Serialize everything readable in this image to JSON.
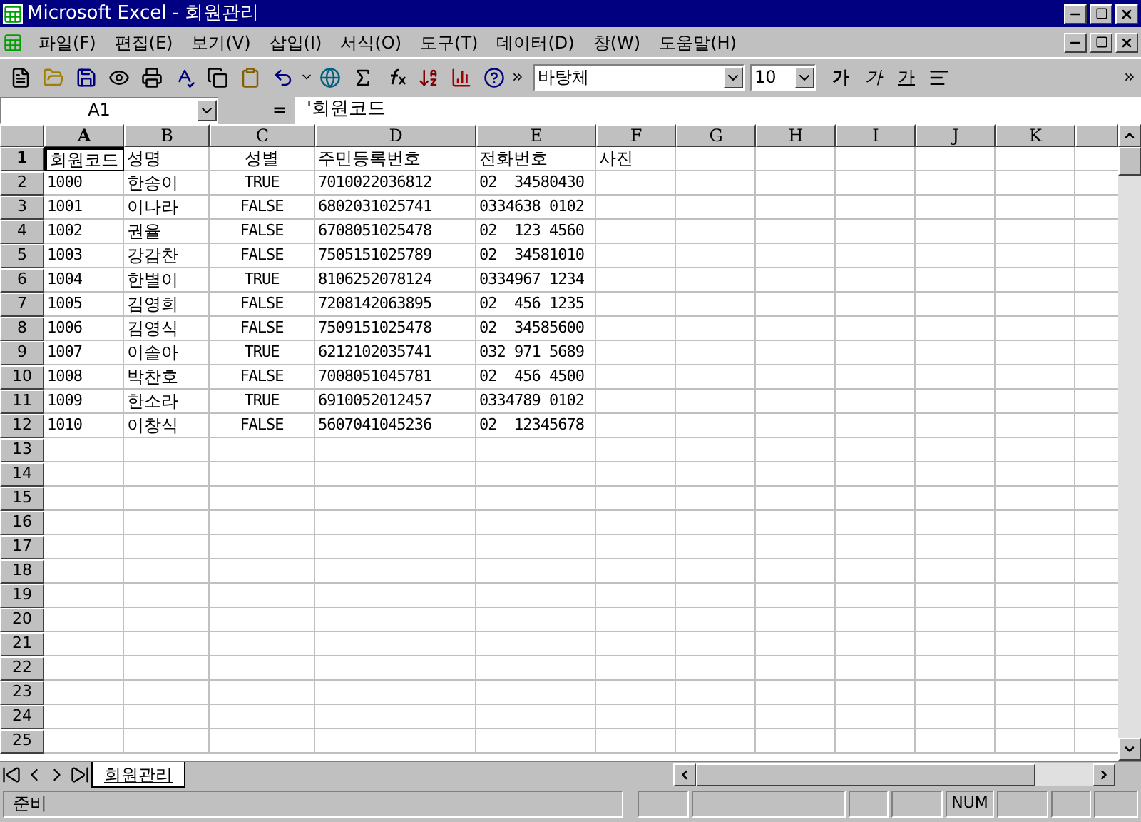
{
  "window": {
    "title": "Microsoft Excel - 회원관리"
  },
  "menu": [
    "파일(F)",
    "편집(E)",
    "보기(V)",
    "삽입(I)",
    "서식(O)",
    "도구(T)",
    "데이터(D)",
    "창(W)",
    "도움말(H)"
  ],
  "toolbar": {
    "font_name": "바탕체",
    "font_size": "10",
    "format_buttons": [
      {
        "label": "가",
        "kind": "bold"
      },
      {
        "label": "가",
        "kind": "italic"
      },
      {
        "label": "가",
        "kind": "underline"
      }
    ]
  },
  "formula_bar": {
    "cell_ref": "A1",
    "equals": "=",
    "content": "'회원코드"
  },
  "sheet": {
    "columns": [
      {
        "label": "A",
        "selected": true,
        "kind": "text"
      },
      {
        "label": "B",
        "selected": false,
        "kind": "text"
      },
      {
        "label": "C",
        "selected": false,
        "kind": "boolean"
      },
      {
        "label": "D",
        "selected": false,
        "kind": "text"
      },
      {
        "label": "E",
        "selected": false,
        "kind": "text"
      },
      {
        "label": "F",
        "selected": false,
        "kind": "text"
      },
      {
        "label": "G",
        "selected": false,
        "kind": "text"
      },
      {
        "label": "H",
        "selected": false,
        "kind": "text"
      },
      {
        "label": "I",
        "selected": false,
        "kind": "text"
      },
      {
        "label": "J",
        "selected": false,
        "kind": "text"
      },
      {
        "label": "K",
        "selected": false,
        "kind": "text"
      }
    ],
    "rows": [
      {
        "header": "1",
        "selected": true,
        "cells": [
          "회원코드",
          "성명",
          "성별",
          "주민등록번호",
          "전화번호",
          "사진"
        ]
      },
      {
        "header": "2",
        "selected": false,
        "cells": [
          "1000",
          "한송이",
          "TRUE",
          "7010022036812",
          "02  34580430"
        ]
      },
      {
        "header": "3",
        "selected": false,
        "cells": [
          "1001",
          "이나라",
          "FALSE",
          "6802031025741",
          "0334638 0102"
        ]
      },
      {
        "header": "4",
        "selected": false,
        "cells": [
          "1002",
          "권율",
          "FALSE",
          "6708051025478",
          "02  123 4560"
        ]
      },
      {
        "header": "5",
        "selected": false,
        "cells": [
          "1003",
          "강감찬",
          "FALSE",
          "7505151025789",
          "02  34581010"
        ]
      },
      {
        "header": "6",
        "selected": false,
        "cells": [
          "1004",
          "한별이",
          "TRUE",
          "8106252078124",
          "0334967 1234"
        ]
      },
      {
        "header": "7",
        "selected": false,
        "cells": [
          "1005",
          "김영희",
          "FALSE",
          "7208142063895",
          "02  456 1235"
        ]
      },
      {
        "header": "8",
        "selected": false,
        "cells": [
          "1006",
          "김영식",
          "FALSE",
          "7509151025478",
          "02  34585600"
        ]
      },
      {
        "header": "9",
        "selected": false,
        "cells": [
          "1007",
          "이솔아",
          "TRUE",
          "6212102035741",
          "032 971 5689"
        ]
      },
      {
        "header": "10",
        "selected": false,
        "cells": [
          "1008",
          "박찬호",
          "FALSE",
          "7008051045781",
          "02  456 4500"
        ]
      },
      {
        "header": "11",
        "selected": false,
        "cells": [
          "1009",
          "한소라",
          "TRUE",
          "6910052012457",
          "0334789 0102"
        ]
      },
      {
        "header": "12",
        "selected": false,
        "cells": [
          "1010",
          "이창식",
          "FALSE",
          "5607041045236",
          "02  12345678"
        ]
      },
      {
        "header": "13",
        "selected": false,
        "cells": []
      },
      {
        "header": "14",
        "selected": false,
        "cells": []
      },
      {
        "header": "15",
        "selected": false,
        "cells": []
      },
      {
        "header": "16",
        "selected": false,
        "cells": []
      },
      {
        "header": "17",
        "selected": false,
        "cells": []
      },
      {
        "header": "18",
        "selected": false,
        "cells": []
      },
      {
        "header": "19",
        "selected": false,
        "cells": []
      },
      {
        "header": "20",
        "selected": false,
        "cells": []
      },
      {
        "header": "21",
        "selected": false,
        "cells": []
      },
      {
        "header": "22",
        "selected": false,
        "cells": []
      },
      {
        "header": "23",
        "selected": false,
        "cells": []
      },
      {
        "header": "24",
        "selected": false,
        "cells": []
      },
      {
        "header": "25",
        "selected": false,
        "cells": []
      }
    ]
  },
  "sheet_tabs": [
    {
      "label": "회원관리",
      "selected": true
    }
  ],
  "status_bar": {
    "text": "준비",
    "indicators": [
      "NUM"
    ]
  }
}
